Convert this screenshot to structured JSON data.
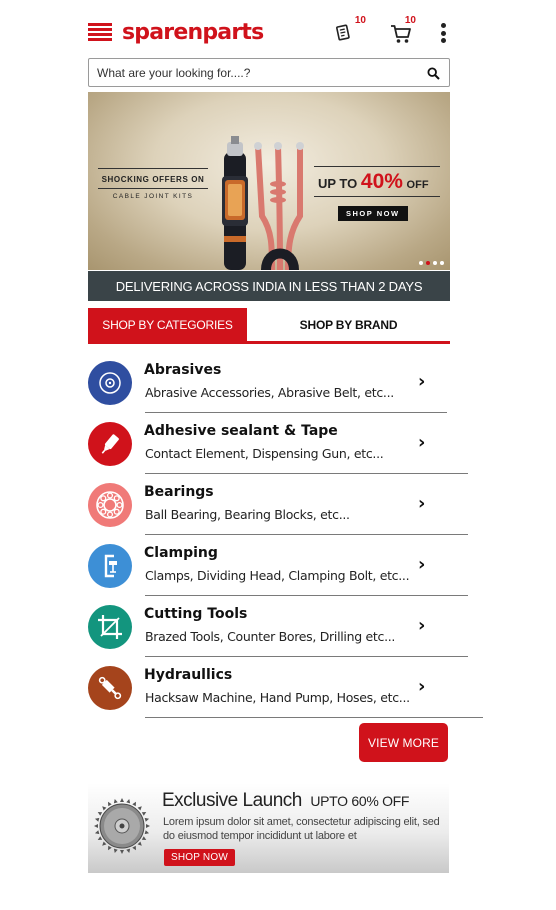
{
  "brand": {
    "logo_text": "sparenparts",
    "accent_color": "#d0121b",
    "menu_icon": "hamburger-menu-icon"
  },
  "header": {
    "quote_icon": "quote-list-icon",
    "quote_count": "10",
    "cart_icon": "cart-icon",
    "cart_count": "10",
    "overflow_icon": "more-vertical-icon"
  },
  "search": {
    "placeholder": "What are your looking for....?",
    "icon": "search-icon"
  },
  "banner": {
    "left_line1": "SHOCKING OFFERS ON",
    "left_line2": "CABLE JOINT KITS",
    "offer_prefix": "UP TO",
    "offer_percent": "40%",
    "offer_suffix": "OFF",
    "button_label": "SHOP NOW",
    "slide_count": 4,
    "active_slide": 2
  },
  "delivery_strip": "DELIVERING ACROSS INDIA IN LESS THAN 2 DAYS",
  "tabs": [
    {
      "label": "SHOP BY CATEGORIES",
      "active": true
    },
    {
      "label": "SHOP BY BRAND",
      "active": false
    }
  ],
  "categories": [
    {
      "title": "Abrasives",
      "subtitle": "Abrasive Accessories, Abrasive Belt, etc...",
      "icon": "abrasive-disc-icon",
      "color": "#2f4ea0"
    },
    {
      "title": "Adhesive sealant & Tape",
      "subtitle": "Contact Element, Dispensing Gun, etc...",
      "icon": "adhesive-tube-icon",
      "color": "#d0121b"
    },
    {
      "title": "Bearings",
      "subtitle": "Ball Bearing, Bearing Blocks, etc...",
      "icon": "bearing-icon",
      "color": "#f07a78"
    },
    {
      "title": "Clamping",
      "subtitle": "Clamps, Dividing Head, Clamping Bolt, etc...",
      "icon": "clamp-icon",
      "color": "#3d8fd6"
    },
    {
      "title": "Cutting Tools",
      "subtitle": "Brazed Tools, Counter Bores, Drilling etc...",
      "icon": "crop-cutting-icon",
      "color": "#13957e"
    },
    {
      "title": "Hydraullics",
      "subtitle": "Hacksaw Machine, Hand Pump, Hoses, etc...",
      "icon": "hydraulic-cylinder-icon",
      "color": "#a5441c"
    }
  ],
  "category_arrow": "›",
  "view_more": "VIEW MORE",
  "promo": {
    "heading": "Exclusive Launch",
    "heading_offer": "UPTO 60% OFF",
    "body": "Lorem ipsum dolor sit amet, consectetur adipiscing elit, sed do eiusmod tempor incididunt ut labore et",
    "button_label": "SHOP NOW",
    "image_icon": "saw-blade-icon"
  }
}
